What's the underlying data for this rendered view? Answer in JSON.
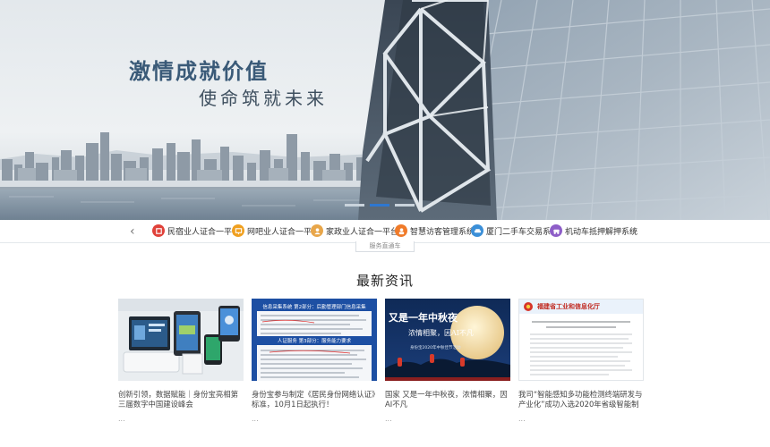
{
  "hero": {
    "title": "激情成就价值",
    "subtitle": "使命筑就未来",
    "slide_count": 3,
    "active_slide": 1
  },
  "services": {
    "prev_icon": "chevron-left-icon",
    "next_icon": "chevron-right-icon",
    "items": [
      {
        "label": "民宿业人证合一平台",
        "icon": "hotel-icon",
        "color": "#e0423a"
      },
      {
        "label": "网吧业人证合一平台",
        "icon": "computer-icon",
        "color": "#f0a020"
      },
      {
        "label": "家政业人证合一平台",
        "icon": "housekeeping-icon",
        "color": "#e8a64a"
      },
      {
        "label": "智慧访客管理系统",
        "icon": "visitor-icon",
        "color": "#f07b2a"
      },
      {
        "label": "厦门二手车交易系统",
        "icon": "car-icon",
        "color": "#3b8fd8"
      },
      {
        "label": "机动车抵押解押系统",
        "icon": "vehicle-icon",
        "color": "#8e5ec8"
      }
    ],
    "tab_label": "服务直通车"
  },
  "news": {
    "heading": "最新资讯",
    "items": [
      {
        "title": "创新引领，数据赋能｜身份宝亮相第三届数字中国建设峰会",
        "more": "..."
      },
      {
        "title": "身份宝参与制定《居民身份网络认证》标准，10月1日起执行！",
        "more": "..."
      },
      {
        "title": "国家 又是一年中秋夜，浓情相聚，因AI不凡",
        "more": "..."
      },
      {
        "title": "我司“智能感知多功能检测终端研发与产业化”成功入选2020年省级智能制造重点项目",
        "more": "..."
      }
    ],
    "thumb_texts": {
      "card2_header": "信息采集系统 第2部分：后勤管理部门信息采集",
      "card2_sub": "人证服务 第3部分：服务能力要求",
      "card3_line1": "又是一年中秋夜",
      "card3_line2": "浓情相聚，因AI不凡",
      "card3_line3": "身份宝2020年中秋佳节活动",
      "card4_header": "福建省工业和信息化厅"
    }
  }
}
